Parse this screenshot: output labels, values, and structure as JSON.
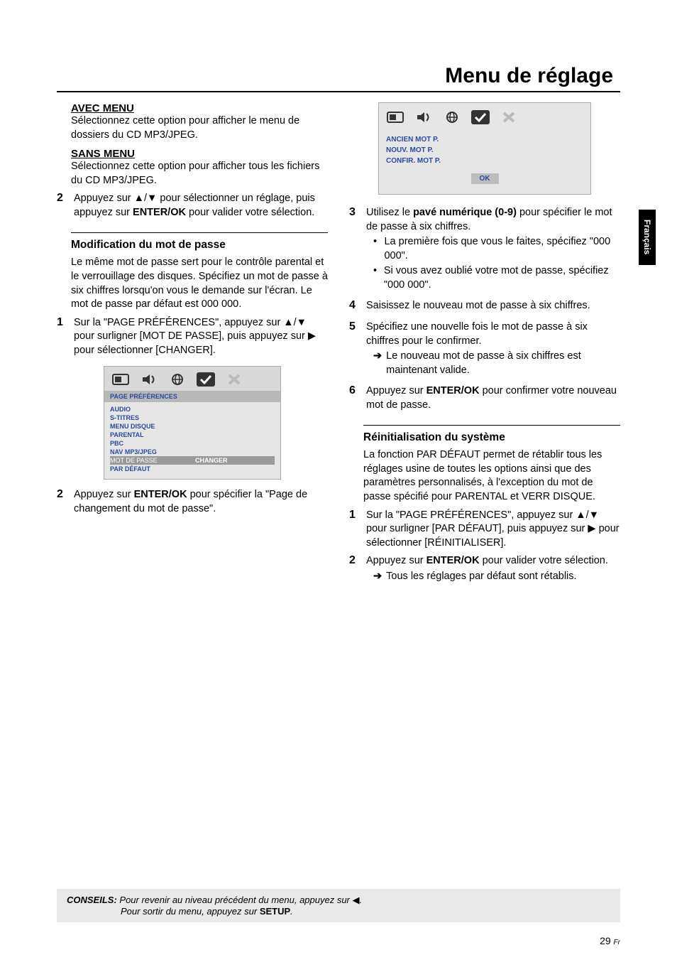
{
  "title": "Menu de réglage",
  "sideTab": "Français",
  "left": {
    "avec_head": "AVEC MENU",
    "avec_body": "Sélectionnez cette option pour afficher le menu de dossiers du CD MP3/JPEG.",
    "sans_head": "SANS MENU",
    "sans_body": "Sélectionnez cette option pour afficher tous les fichiers du CD MP3/JPEG.",
    "step2_num": "2",
    "step2_a": "Appuyez sur ",
    "step2_tri": "▲/▼",
    "step2_b": " pour sélectionner un réglage, puis appuyez sur ",
    "step2_enter": "ENTER/OK",
    "step2_c": " pour valider votre sélection.",
    "mod_head": "Modification du mot de passe",
    "mod_body": "Le même mot de passe sert pour le contrôle parental et le verrouillage des disques. Spécifiez un mot de passe à six chiffres lorsqu'on vous le demande sur l'écran. Le mot de passe par défaut est 000 000.",
    "m_step1_num": "1",
    "m_step1_a": "Sur la \"PAGE PRÉFÉRENCES\", appuyez sur ",
    "m_step1_tri": "▲/▼",
    "m_step1_b": " pour surligner [MOT DE PASSE], puis appuyez sur ",
    "m_step1_play": "▶",
    "m_step1_c": " pour sélectionner [CHANGER].",
    "osd1_section": "PAGE PRÉFÉRENCES",
    "osd1_items": [
      "AUDIO",
      "S-TITRES",
      "MENU DISQUE",
      "PARENTAL",
      "PBC",
      "NAV MP3/JPEG"
    ],
    "osd1_hl_left": "MOT DE PASSE",
    "osd1_hl_right": "CHANGER",
    "osd1_last": "PAR DÉFAUT",
    "m_step2_num": "2",
    "m_step2_a": "Appuyez sur ",
    "m_step2_enter": "ENTER/OK",
    "m_step2_b": " pour spécifier la \"Page de changement du mot de passe\"."
  },
  "right": {
    "osd2_labels": [
      "ANCIEN MOT P.",
      "NOUV. MOT P.",
      "CONFIR. MOT P."
    ],
    "osd2_ok": "OK",
    "r3_num": "3",
    "r3_a": "Utilisez le ",
    "r3_bold": "pavé numérique (0-9)",
    "r3_b": " pour spécifier le mot de passe à six chiffres.",
    "r3_bul1": "La première fois que vous le faites, spécifiez \"000 000\".",
    "r3_bul2": "Si vous avez oublié votre mot de passe, spécifiez \"000 000\".",
    "r4_num": "4",
    "r4": "Saisissez le nouveau mot de passe à six chiffres.",
    "r5_num": "5",
    "r5": "Spécifiez une nouvelle fois le mot de passe à six chiffres pour le confirmer.",
    "r5_arrow": "Le nouveau mot de passe à six chiffres est maintenant valide.",
    "r6_num": "6",
    "r6_a": "Appuyez sur ",
    "r6_enter": "ENTER/OK",
    "r6_b": " pour confirmer votre nouveau mot de passe.",
    "reinit_head": "Réinitialisation du système",
    "reinit_body": "La fonction PAR DÉFAUT permet de rétablir tous les réglages usine de toutes les options ainsi que des paramètres personnalisés, à l'exception du mot de passe spécifié pour PARENTAL et VERR DISQUE.",
    "re1_num": "1",
    "re1_a": "Sur la \"PAGE PRÉFÉRENCES\", appuyez sur ",
    "re1_tri": "▲/▼",
    "re1_b": " pour surligner [PAR DÉFAUT], puis appuyez sur ",
    "re1_play": "▶",
    "re1_c": " pour sélectionner [RÉINITIALISER].",
    "re2_num": "2",
    "re2_a": "Appuyez sur ",
    "re2_enter": "ENTER/OK",
    "re2_b": " pour valider votre sélection.",
    "re2_arrow": "Tous les réglages par défaut sont rétablis."
  },
  "footer": {
    "label": "CONSEILS:",
    "line1_a": " Pour revenir au niveau précédent du menu, appuyez sur ",
    "line1_tri": "◀",
    "line1_b": ".",
    "line2_a": "Pour sortir du menu, appuyez sur ",
    "line2_bold": "SETUP",
    "line2_b": "."
  },
  "pageNum": "29",
  "pageNumSuffix": "Fr"
}
